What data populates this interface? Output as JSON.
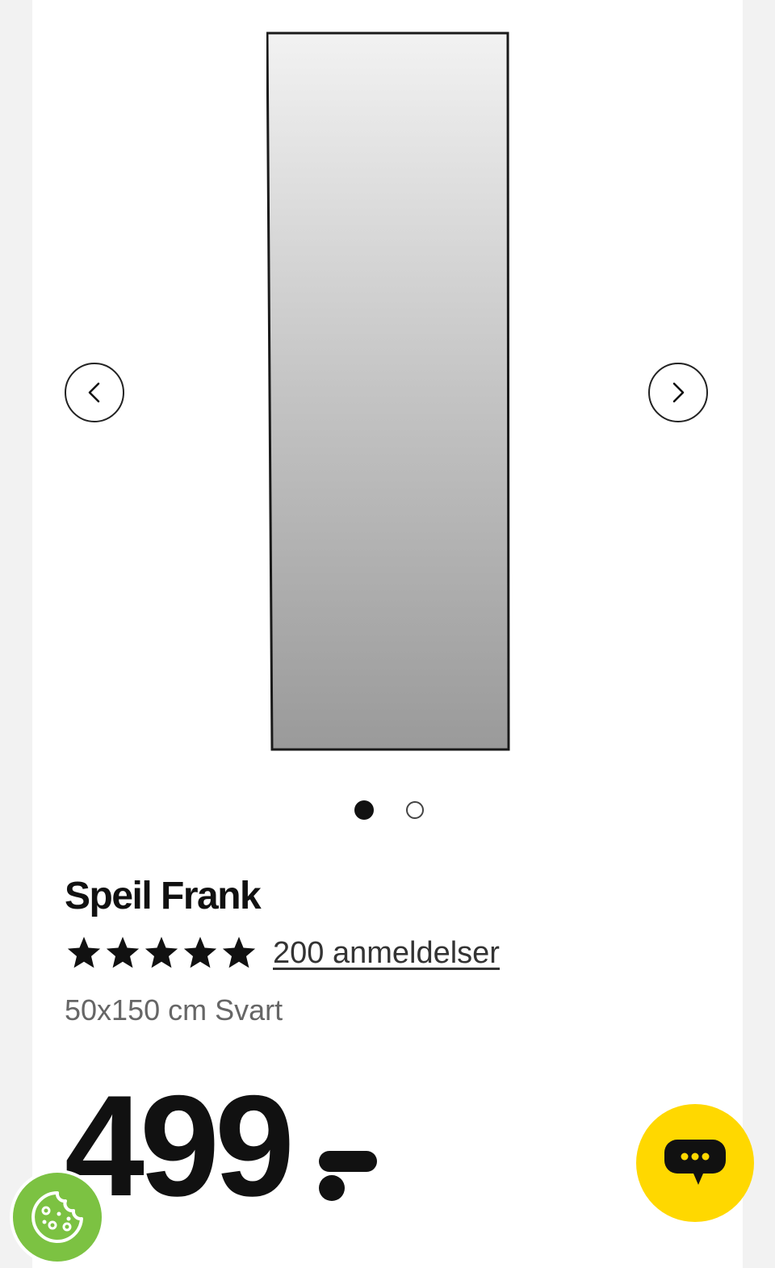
{
  "product": {
    "title": "Speil Frank",
    "rating": 5,
    "rating_max": 5,
    "reviews_label": "200 anmeldelser",
    "variant": "50x150 cm Svart",
    "price_number": "499"
  },
  "gallery": {
    "current_slide": 1,
    "total_slides": 2,
    "prev_icon": "chevron-left-icon",
    "next_icon": "chevron-right-icon"
  },
  "floating": {
    "chat_icon": "chat-bubble-icon",
    "cookie_icon": "cookie-icon"
  },
  "colors": {
    "chat_bg": "#ffd800",
    "cookie_bg": "#7cc242",
    "text": "#111111",
    "muted": "#666666"
  }
}
